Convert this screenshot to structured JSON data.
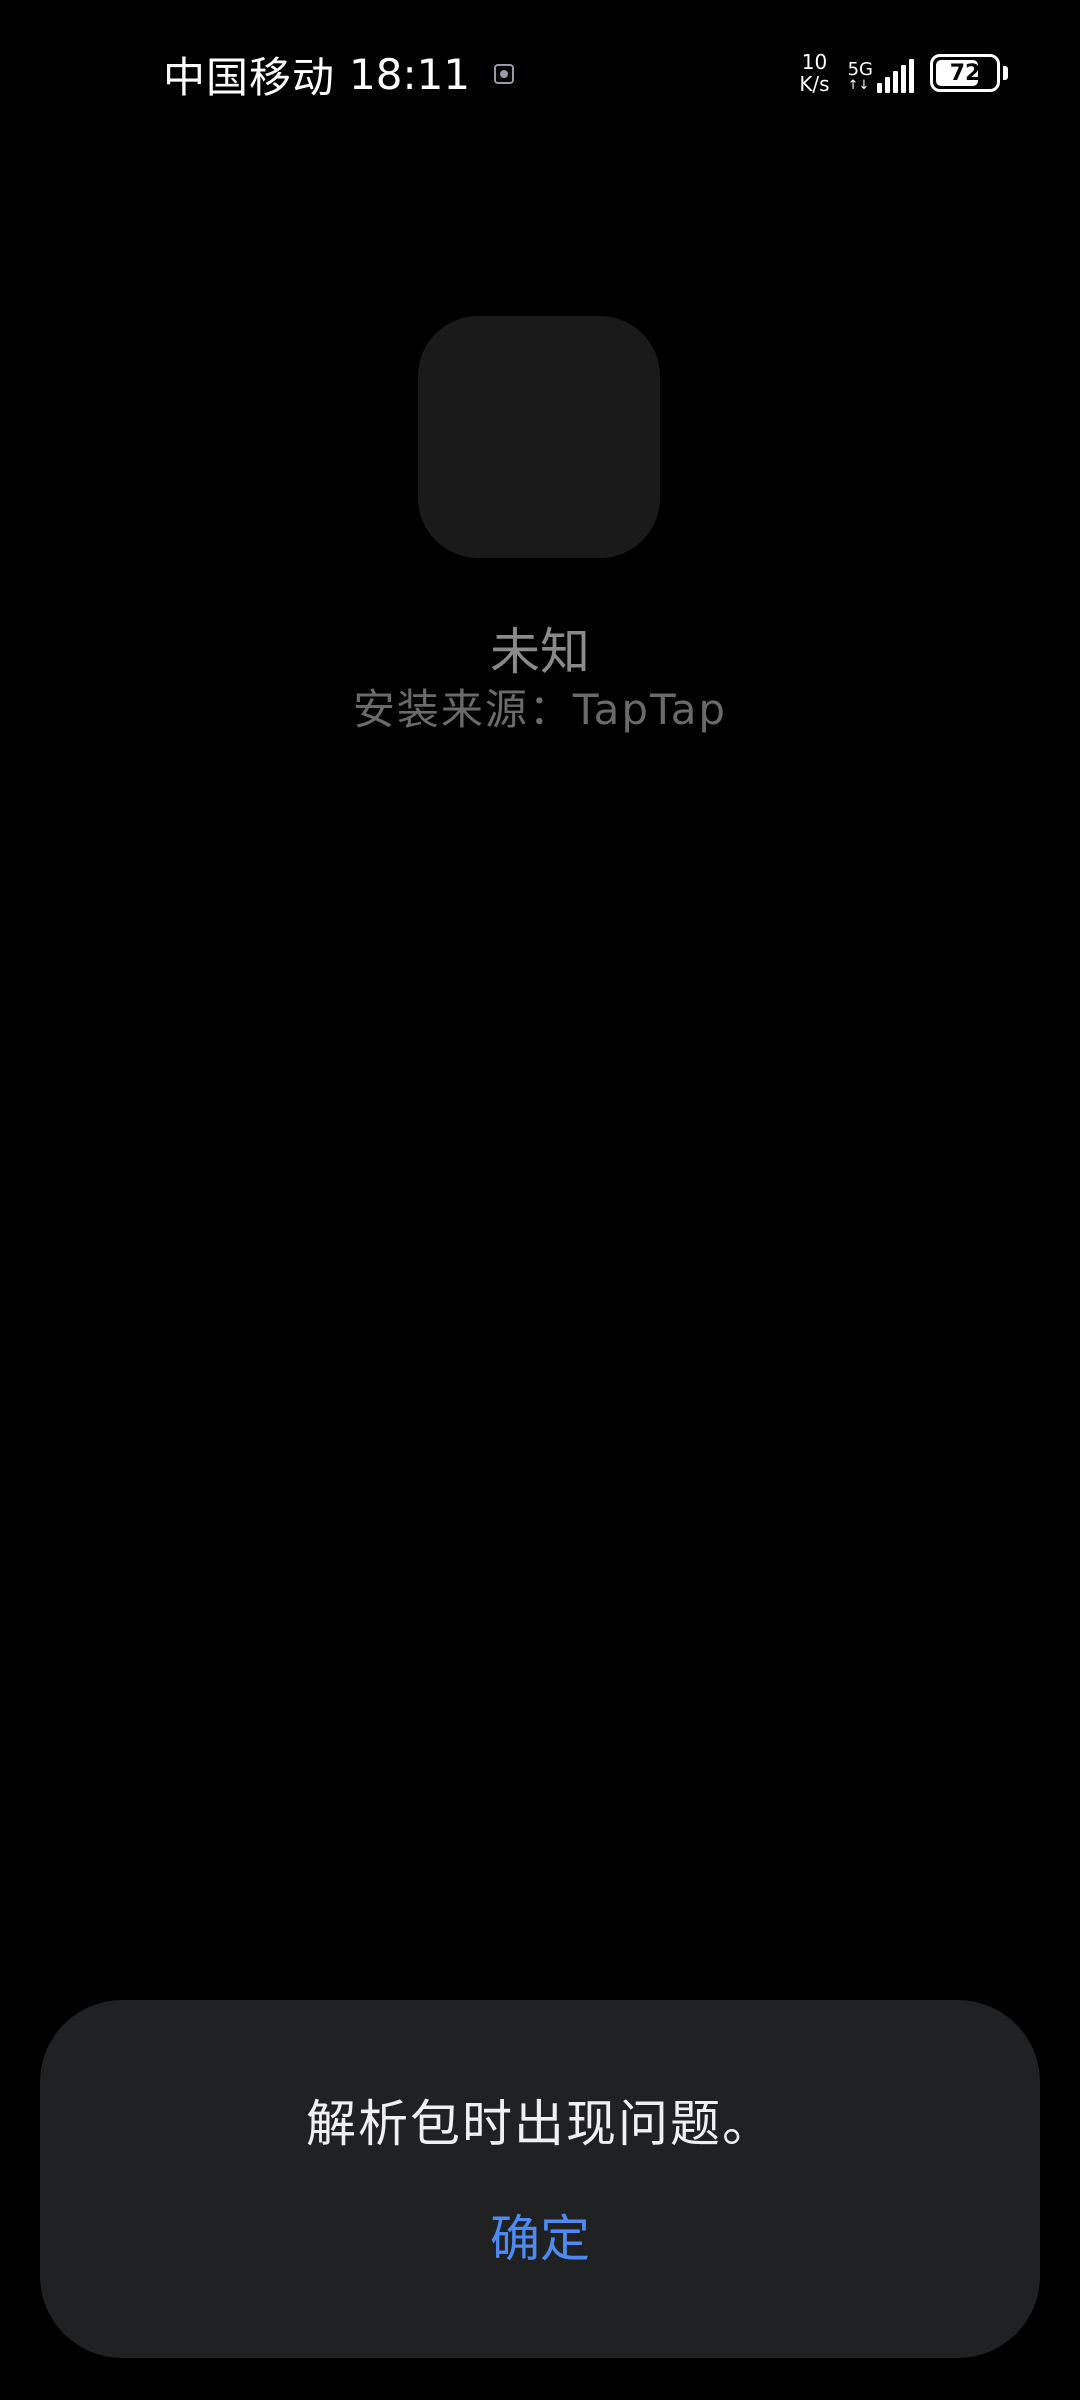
{
  "status_bar": {
    "carrier": "中国移动",
    "time": "18:11",
    "notification_icon": "notification-app-icon",
    "net_speed_value": "10",
    "net_speed_unit": "K/s",
    "network_type": "5G",
    "network_arrows": "↑↓",
    "signal_icon": "cellular-signal-icon",
    "battery_level": "72",
    "battery_percent": 72
  },
  "app_info": {
    "icon": "app-placeholder-icon",
    "name": "未知",
    "install_source": "安装来源：TapTap"
  },
  "dialog": {
    "message": "解析包时出现问题。",
    "confirm_label": "确定",
    "confirm_color": "#4f8af0"
  },
  "colors": {
    "background": "#000000",
    "dialog_background": "#202123",
    "accent": "#4f8af0"
  }
}
